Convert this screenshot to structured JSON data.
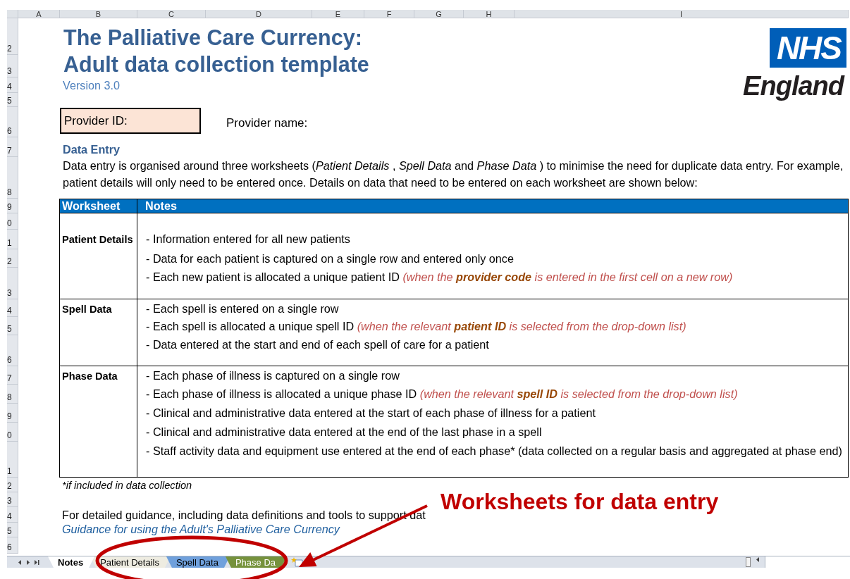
{
  "column_headers": [
    "A",
    "B",
    "C",
    "D",
    "E",
    "F",
    "G",
    "H",
    "I"
  ],
  "row_headers": [
    "2",
    "3",
    "4",
    "5",
    "6",
    "7",
    "8",
    "9",
    "0",
    "1",
    "2",
    "3",
    "4",
    "5",
    "6",
    "7",
    "8",
    "9",
    "0",
    "1",
    "2",
    "3",
    "4",
    "5",
    "6"
  ],
  "title": [
    "The Palliative Care Currency:",
    "Adult data collection template"
  ],
  "version": "Version 3.0",
  "logo": {
    "mark": "NHS",
    "region": "England"
  },
  "provider_id": {
    "label": "Provider ID:"
  },
  "provider_name": {
    "label": "Provider name:"
  },
  "data_entry": {
    "heading": "Data Entry",
    "lines": [
      "Data entry is organised around three worksheets (*Patient Details* , *Spell Data*  and *Phase Data* ) to minimise the need for duplicate data entry.  For example,",
      "patient details will only need to be entered once.  Details on data that need to be entered on each worksheet are shown below:"
    ]
  },
  "table": {
    "columns": [
      "Worksheet",
      "Notes"
    ],
    "rows": [
      {
        "worksheet": "Patient Details",
        "notes": [
          {
            "text": "- Information entered for all new patients"
          },
          {
            "text": "- Data for each patient is captured on a single row and entered only once"
          },
          {
            "text": "- Each new patient is allocated a unique patient ID",
            "note": "(when the  **provider code**  is entered in the first cell on a new row)"
          }
        ]
      },
      {
        "worksheet": "Spell Data",
        "notes": [
          {
            "text": "- Each spell is entered on a single row"
          },
          {
            "text": "- Each spell is allocated a unique spell ID",
            "note": "(when the relevant  **patient ID**  is selected from the drop-down list)"
          },
          {
            "text": "- Data entered at the start and end of each spell of care for a patient"
          }
        ]
      },
      {
        "worksheet": "Phase Data",
        "notes": [
          {
            "text": "- Each phase of illness is captured on a single row"
          },
          {
            "text": "- Each phase of illness is allocated a unique phase ID",
            "note": "(when the relevant  **spell ID**  is selected from the drop-down list)"
          },
          {
            "text": "- Clinical and administrative data entered at the start of each phase of illness for a patient"
          },
          {
            "text": "- Clinical and administrative data entered at the end of the last phase in a spell"
          },
          {
            "text": "- Staff activity data and equipment use entered at the end of each phase* (data collected on a regular basis and aggregated at phase end)"
          }
        ]
      }
    ]
  },
  "footnote": "*if included in data collection",
  "guidance": {
    "text": "For detailed guidance, including data definitions and tools to support dat",
    "link": "Guidance for using the Adult's Palliative Care Currency"
  },
  "sheet_tabs": [
    {
      "label": "Notes",
      "selected": true,
      "color": "#ffffff"
    },
    {
      "label": "Patient Details",
      "selected": false,
      "color": "#eeece1"
    },
    {
      "label": "Spell Data",
      "selected": false,
      "color": "#6fa0dc"
    },
    {
      "label": "Phase Da",
      "selected": false,
      "color": "#76923c"
    }
  ],
  "callout": {
    "text": "Worksheets for data entry"
  }
}
